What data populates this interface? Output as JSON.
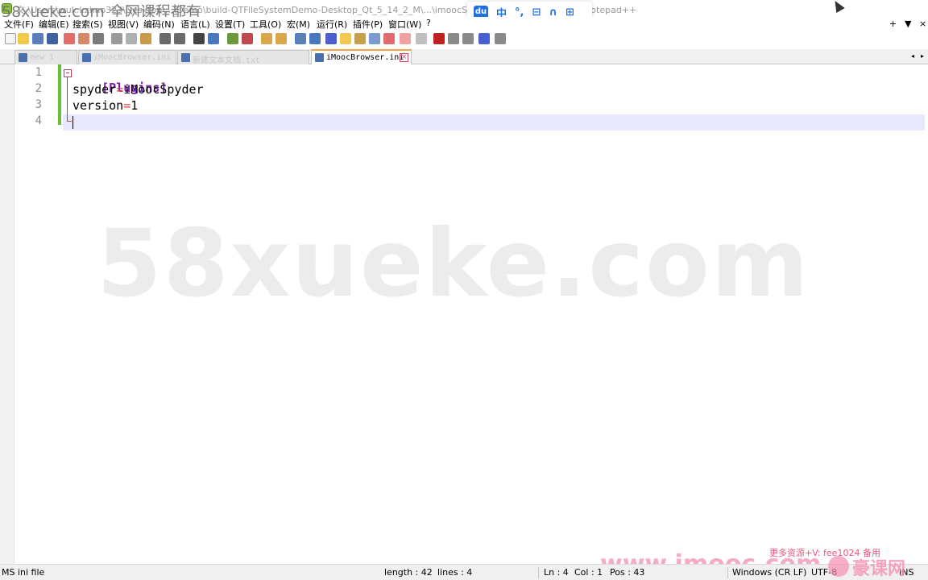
{
  "window": {
    "title": "文 \\Users\\wuk.kzhao323\\Desktop\\...\\Demo\\build-QTFileSystemDemo-Desktop_Qt_5_14_2_M\\...\\imoocSettings\\iMoocBrowser.ini - Notepad++",
    "overlay_watermark": "58xueke.com 全网课程都有"
  },
  "ime": {
    "items": [
      "du",
      "中",
      "°,",
      "⊟",
      "∩",
      "⊞"
    ]
  },
  "menu": {
    "items": [
      "文件(F)",
      "编辑(E)",
      "搜索(S)",
      "视图(V)",
      "编码(N)",
      "语言(L)",
      "设置(T)",
      "工具(O)",
      "宏(M)",
      "运行(R)",
      "插件(P)",
      "窗口(W)",
      "?"
    ],
    "right": [
      "+",
      "▼",
      "×"
    ]
  },
  "tabs": {
    "items": [
      {
        "label": "new 1"
      },
      {
        "label": "iMoocBrowser.ini"
      },
      {
        "label": "新建文本文档.txt"
      },
      {
        "label": "iMoocBrowser.ini"
      }
    ],
    "scroll_left": "◂",
    "scroll_right": "▸"
  },
  "editor": {
    "line_numbers": [
      "1",
      "2",
      "3",
      "4"
    ],
    "lines": [
      {
        "section": "[Plugins]"
      },
      {
        "key": "spyder",
        "eq": "=",
        "value": "iMoocSpyder"
      },
      {
        "key": "version",
        "eq": "=",
        "value": "1"
      },
      {
        "text": ""
      }
    ],
    "watermark": "58xueke.com"
  },
  "status": {
    "file_type": "MS ini file",
    "length": "length : 42",
    "lines": "lines : 4",
    "ln": "Ln : 4",
    "col": "Col : 1",
    "pos": "Pos : 43",
    "eol": "Windows (CR LF)",
    "encoding": "UTF-8",
    "mode": "INS"
  },
  "overlay": {
    "imooc": "www.imooc.com",
    "contact": "更多资源+V: fee1024 备用",
    "logo": "豪课网"
  },
  "colors": {
    "section": "#7a1fb0",
    "eq": "#e04040",
    "current_line": "#e8e8ff",
    "fold_margin": "#6abf3a",
    "tab_active_top": "#f7a540"
  }
}
